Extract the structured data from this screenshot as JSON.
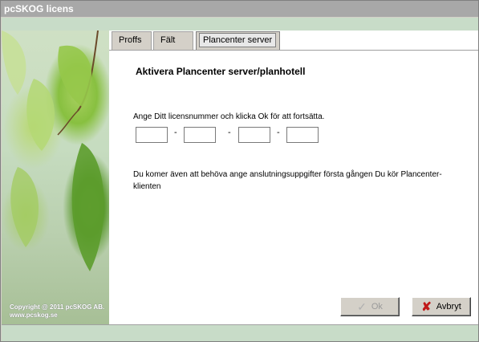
{
  "window": {
    "title": "pcSKOG licens"
  },
  "sidebar": {
    "copyright_line1": "Copyright @ 2011 pcSKOG AB.",
    "copyright_line2": "www.pcskog.se"
  },
  "tabs": [
    {
      "label": "Proffs",
      "active": false
    },
    {
      "label": "Fält",
      "active": false
    },
    {
      "label": "Plancenter server",
      "active": true
    }
  ],
  "panel": {
    "title": "Aktivera Plancenter server/planhotell",
    "instruction": "Ange Ditt licensnummer och klicka Ok för att fortsätta.",
    "license_fields": [
      "",
      "",
      "",
      ""
    ],
    "separator": "-",
    "note": "Du komer även att behöva ange anslutningsuppgifter första gången Du kör Plancenter-klienten"
  },
  "buttons": {
    "ok_label": "Ok",
    "cancel_label": "Avbryt"
  },
  "icons": {
    "ok": "check-icon",
    "cancel": "x-icon"
  },
  "colors": {
    "accent_green": "#c8dcc8",
    "titlebar": "#a8a8a8",
    "cancel_icon": "#c01818"
  }
}
